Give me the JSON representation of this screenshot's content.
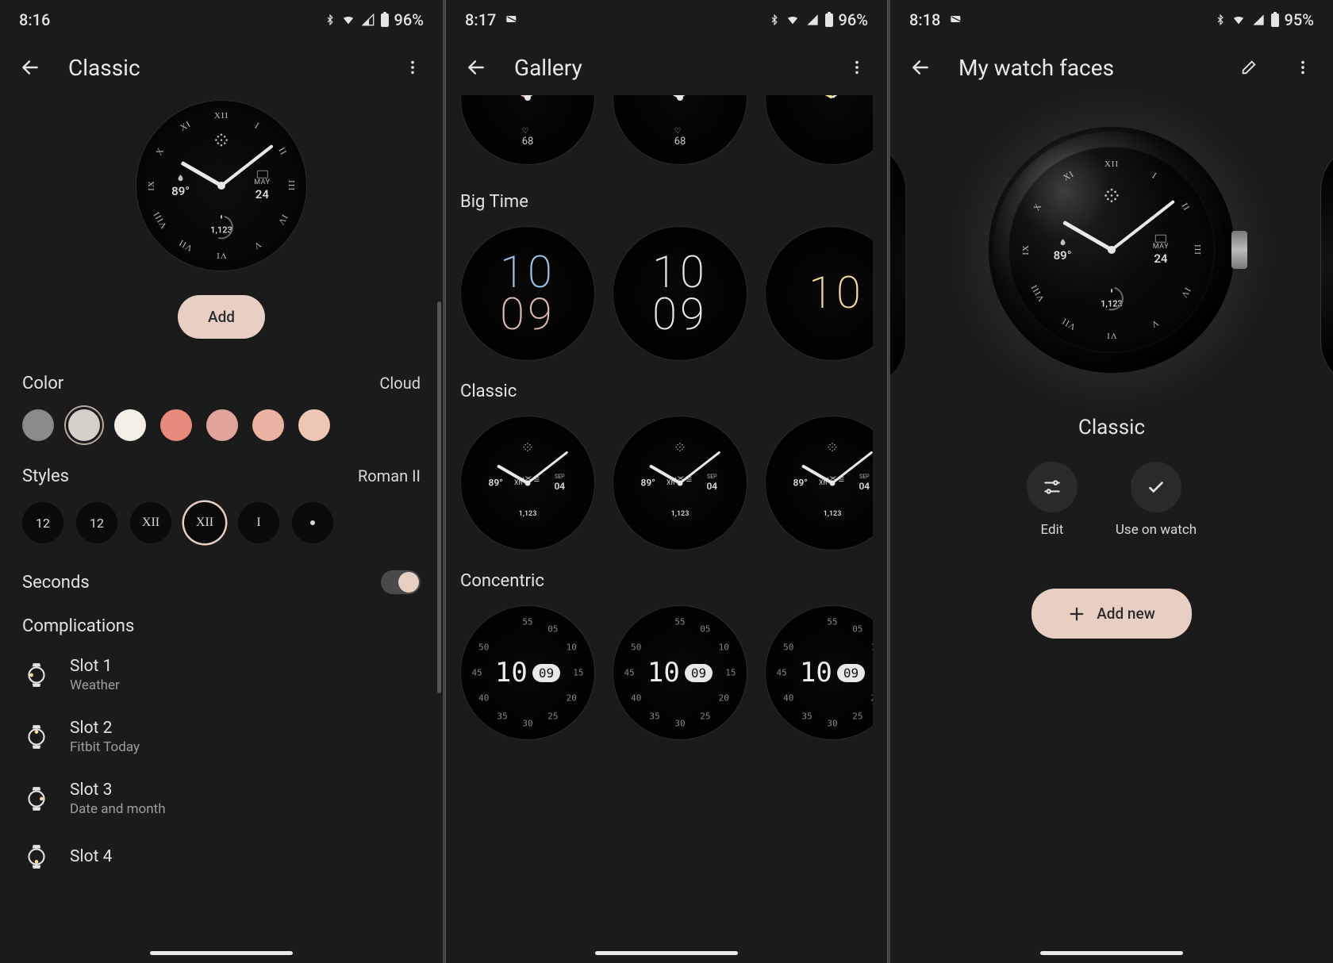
{
  "screen1": {
    "status": {
      "time": "8:16",
      "battery": "96%"
    },
    "title": "Classic",
    "preview": {
      "temp": "89°",
      "month": "MAY",
      "day": "24",
      "steps": "1,123"
    },
    "add_label": "Add",
    "color": {
      "heading": "Color",
      "selected_name": "Cloud",
      "swatches": [
        "#8b8b8b",
        "#d6d1c8",
        "#f4efe6",
        "#e68b7c",
        "#e2a49a",
        "#e9b2a3",
        "#edc6b6"
      ],
      "selected_index": 1
    },
    "styles": {
      "heading": "Styles",
      "selected_name": "Roman II",
      "chips": [
        "12",
        "12",
        "XII",
        "XII",
        "I",
        "•"
      ],
      "selected_index": 3
    },
    "seconds": {
      "label": "Seconds",
      "on": true
    },
    "complications": {
      "heading": "Complications",
      "items": [
        {
          "title": "Slot 1",
          "sub": "Weather",
          "icon": "watch-left"
        },
        {
          "title": "Slot 2",
          "sub": "Fitbit Today",
          "icon": "watch-top"
        },
        {
          "title": "Slot 3",
          "sub": "Date and month",
          "icon": "watch-right"
        },
        {
          "title": "Slot 4",
          "sub": "",
          "icon": "watch-bottom"
        }
      ]
    }
  },
  "screen2": {
    "status": {
      "time": "8:17",
      "battery": "96%"
    },
    "title": "Gallery",
    "sections": [
      {
        "name": "Big Time",
        "time_top": "10",
        "time_bot": "09"
      },
      {
        "name": "Classic",
        "preview": {
          "temp": "89°",
          "month": "SEP",
          "day": "04",
          "steps": "1,123"
        }
      },
      {
        "name": "Concentric",
        "hour": "10",
        "minute": "09",
        "outer_numbers": [
          "55",
          "05",
          "10",
          "15",
          "20",
          "25",
          "30",
          "35",
          "40",
          "45",
          "50"
        ]
      }
    ]
  },
  "screen3": {
    "status": {
      "time": "8:18",
      "battery": "95%"
    },
    "title": "My watch faces",
    "preview": {
      "temp": "89°",
      "month": "MAY",
      "day": "24",
      "steps": "1,123"
    },
    "face_name": "Classic",
    "edit_label": "Edit",
    "use_label": "Use on watch",
    "add_new_label": "Add new"
  }
}
